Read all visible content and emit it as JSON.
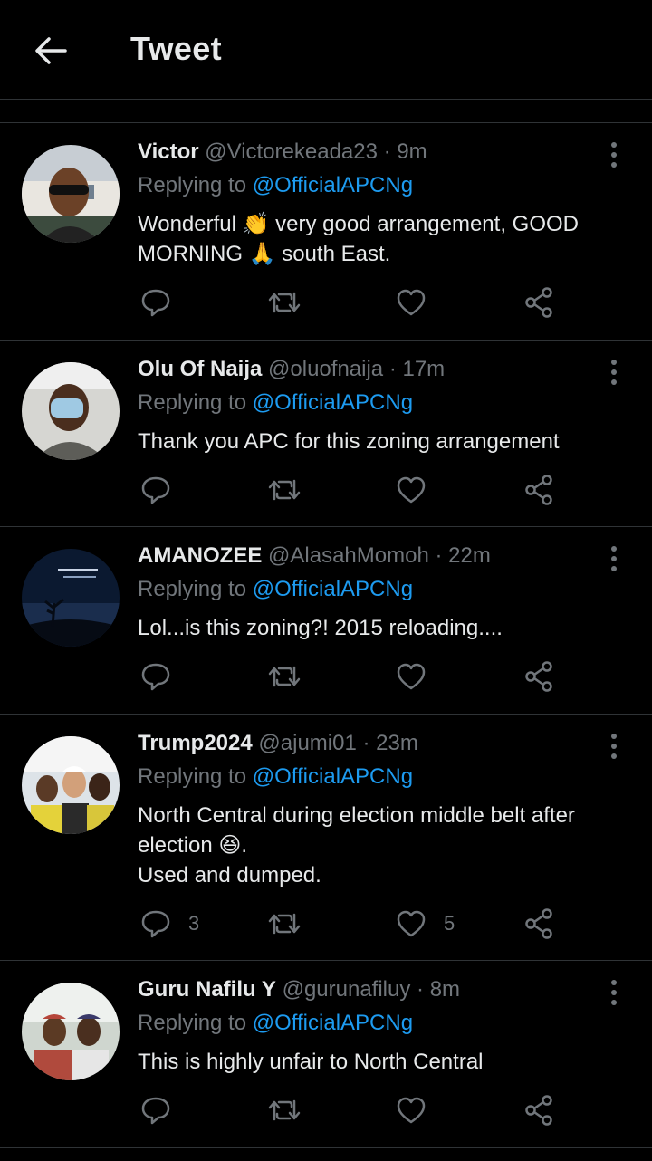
{
  "header": {
    "title": "Tweet"
  },
  "colors": {
    "background": "#000000",
    "text": "#e7e9ea",
    "secondary": "#71767b",
    "accent": "#1d9bf0",
    "divider": "#2f3336"
  },
  "reply_prefix": "Replying to",
  "tweets": [
    {
      "name": "Victor",
      "handle": "@Victorekeada23",
      "time": "· 9m",
      "replying_to": "@OfficialAPCNg",
      "text_lines": [
        "Wonderful 👏 very  good arrangement, GOOD",
        "MORNING 🙏 south  East."
      ],
      "replies": "",
      "likes": ""
    },
    {
      "name": "Olu Of Naija",
      "handle": "@oluofnaija",
      "time": "· 17m",
      "replying_to": "@OfficialAPCNg",
      "text_lines": [
        "Thank you APC for this zoning arrangement"
      ],
      "replies": "",
      "likes": ""
    },
    {
      "name": "AMANOZEE",
      "handle": "@AlasahMomoh",
      "time": "· 22m",
      "replying_to": "@OfficialAPCNg",
      "text_lines": [
        "Lol...is this zoning?! 2015 reloading...."
      ],
      "replies": "",
      "likes": ""
    },
    {
      "name": "Trump2024",
      "handle": "@ajumi01",
      "time": "· 23m",
      "replying_to": "@OfficialAPCNg",
      "text_lines": [
        "North Central during election middle belt after",
        "election 😆.",
        "Used and dumped."
      ],
      "replies": "3",
      "likes": "5"
    },
    {
      "name": "Guru Nafilu Y",
      "handle": "@gurunafiluy",
      "time": "· 8m",
      "replying_to": "@OfficialAPCNg",
      "text_lines": [
        "This is highly unfair to North Central"
      ],
      "replies": "",
      "likes": ""
    }
  ],
  "icons": {
    "back": "arrow-left-icon",
    "more": "more-vertical-icon",
    "reply": "reply-icon",
    "retweet": "retweet-icon",
    "like": "heart-icon",
    "share": "share-icon"
  }
}
